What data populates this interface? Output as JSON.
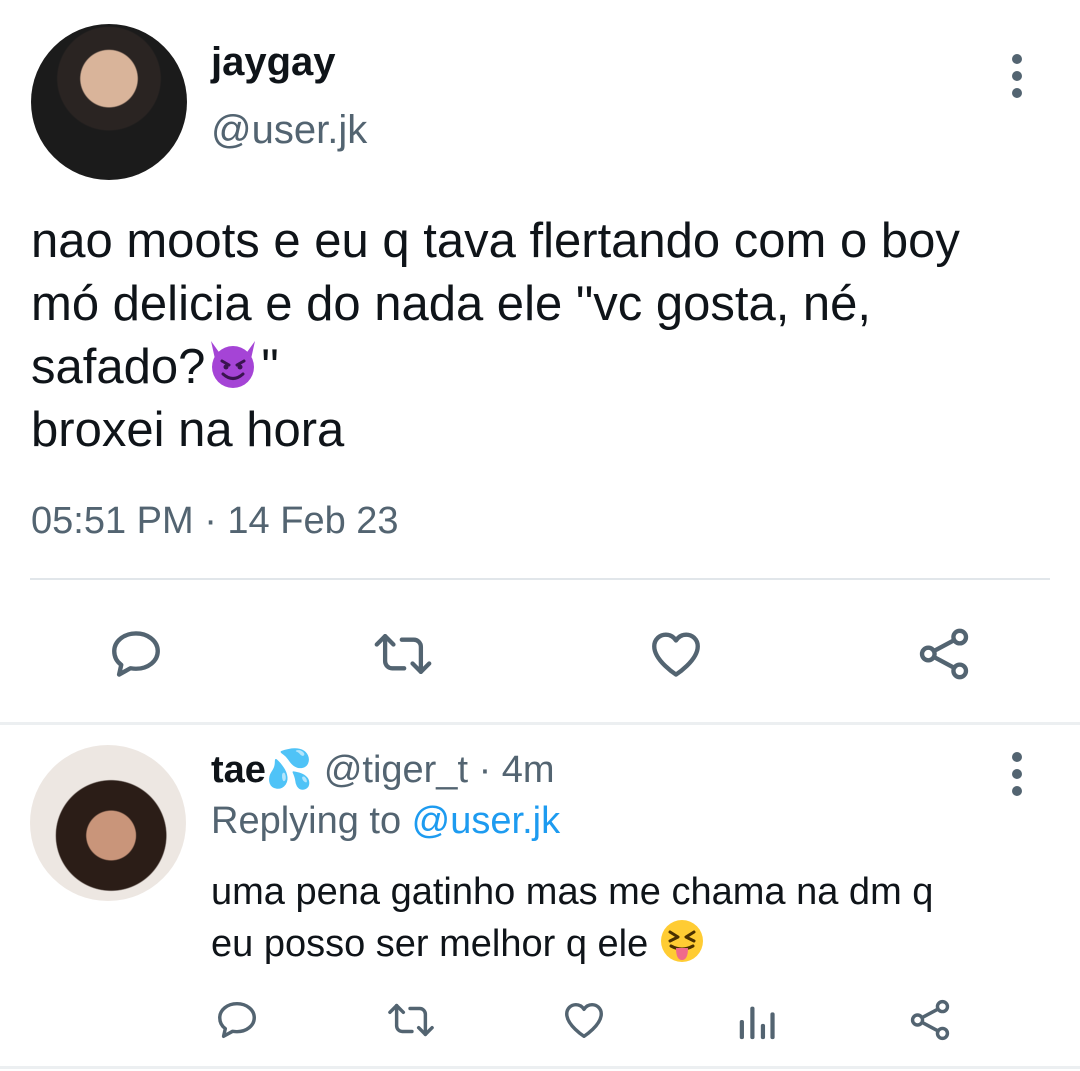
{
  "tweet": {
    "display_name": "jaygay",
    "handle": "@user.jk",
    "text_1": "nao moots e eu q tava flertando com o boy\nmó delicia e do nada ele \"vc gosta, né,\nsafado?",
    "text_2": "\"\nbroxei na hora",
    "emoji_1": "😈",
    "timestamp": "05:51 PM · 14 Feb 23"
  },
  "reply": {
    "display_name": "tae",
    "name_emoji": "💦",
    "handle": "@tiger_t",
    "separator": " · ",
    "time": "4m",
    "replying_prefix": "Replying to ",
    "replying_handle": "@user.jk",
    "text": "uma pena gatinho mas me chama na dm q\neu posso ser melhor q ele ",
    "text_emoji": "😝"
  },
  "icons": {
    "reply": "reply-icon",
    "retweet": "retweet-icon",
    "like": "heart-icon",
    "share": "share-icon",
    "analytics": "analytics-icon",
    "more": "more-vertical-icon"
  },
  "colors": {
    "text": "#0f1419",
    "secondary": "#536471",
    "link": "#1d9bf0",
    "divider": "#e1e6ea"
  }
}
